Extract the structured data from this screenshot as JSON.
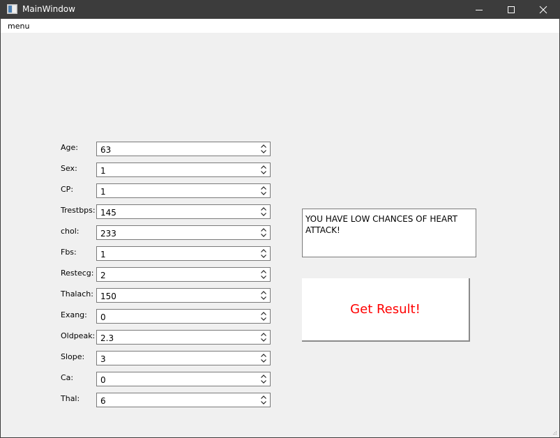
{
  "window": {
    "title": "MainWindow"
  },
  "menubar": {
    "items": [
      "menu"
    ]
  },
  "fields": [
    {
      "label": "Age:",
      "value": "63"
    },
    {
      "label": "Sex:",
      "value": "1"
    },
    {
      "label": "CP:",
      "value": "1"
    },
    {
      "label": "Trestbps:",
      "value": "145"
    },
    {
      "label": "chol:",
      "value": "233"
    },
    {
      "label": "Fbs:",
      "value": "1"
    },
    {
      "label": "Restecg:",
      "value": "2"
    },
    {
      "label": "Thalach:",
      "value": "150"
    },
    {
      "label": "Exang:",
      "value": "0"
    },
    {
      "label": "Oldpeak:",
      "value": "2.3"
    },
    {
      "label": "Slope:",
      "value": "3"
    },
    {
      "label": "Ca:",
      "value": "0"
    },
    {
      "label": "Thal:",
      "value": "6"
    }
  ],
  "result": {
    "text": "YOU HAVE LOW CHANCES OF HEART ATTACK!"
  },
  "button": {
    "label": "Get Result!",
    "color": "#ff0000"
  },
  "icons": {
    "app": "window-app-icon",
    "minimize": "minimize-icon",
    "maximize": "maximize-icon",
    "close": "close-icon"
  }
}
